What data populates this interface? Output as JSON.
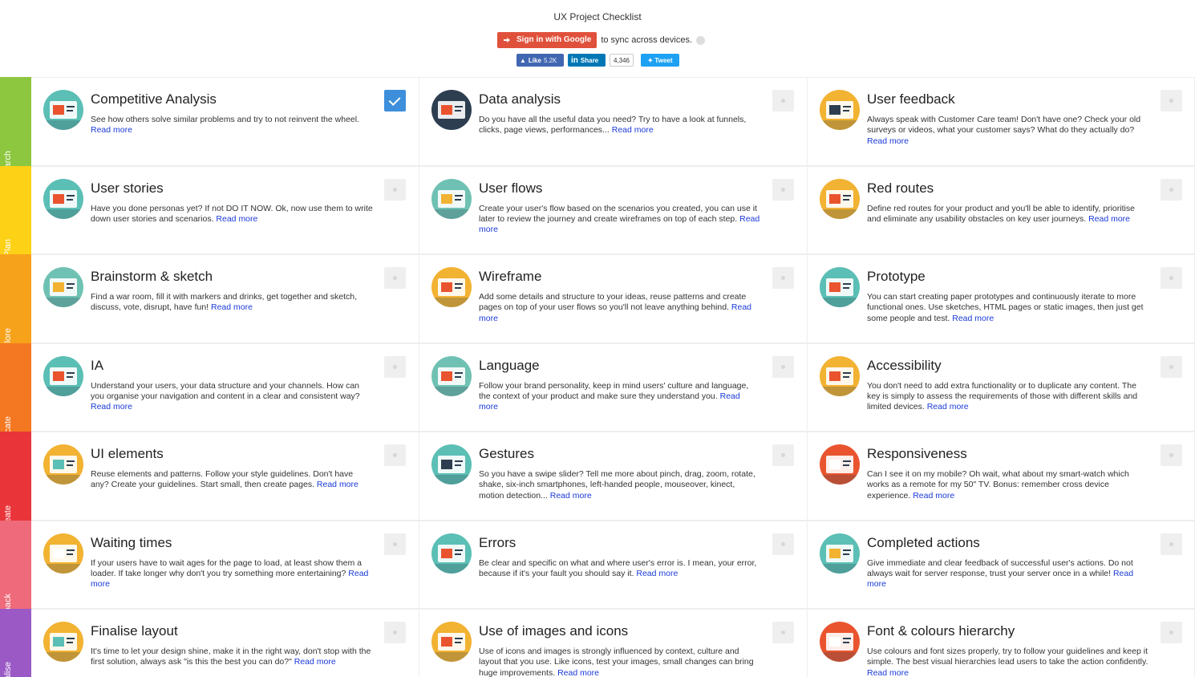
{
  "header": {
    "title": "UX Project Checklist",
    "signin_label": "Sign in with Google",
    "sync_text": "to sync across devices.",
    "facebook_like": "Like",
    "facebook_count": "5.2K",
    "linkedin_label": "Share",
    "linkedin_count": "4,346",
    "tweet_label": "Tweet"
  },
  "read_more": "Read more",
  "stages": [
    {
      "label": "Research",
      "color": "#8dc63f"
    },
    {
      "label": "Plan",
      "color": "#fcd116"
    },
    {
      "label": "Explore",
      "color": "#f7a21b"
    },
    {
      "label": "Communicate",
      "color": "#f47721"
    },
    {
      "label": "Create",
      "color": "#e9353a"
    },
    {
      "label": "Give feedback",
      "color": "#ef6a7a"
    },
    {
      "label": "Finalise",
      "color": "#9b59c5"
    }
  ],
  "items": [
    {
      "title": "Competitive Analysis",
      "desc": "See how others solve similar problems and try to not reinvent the wheel.",
      "checked": true,
      "icon": "magnifier-icon",
      "icon_bg": "#5bbfb5",
      "icon_fg": "#e9542f"
    },
    {
      "title": "Data analysis",
      "desc": "Do you have all the useful data you need? Try to have a look at funnels, clicks, page views, performances...",
      "checked": false,
      "icon": "analytics-icon",
      "icon_bg": "#2d3e50",
      "icon_fg": "#e9542f"
    },
    {
      "title": "User feedback",
      "desc": "Always speak with Customer Care team! Don't have one? Check your old surveys or videos, what your customer says? What do they actually do?",
      "checked": false,
      "icon": "feedback-icon",
      "icon_bg": "#f2b232",
      "icon_fg": "#2d3e50"
    },
    {
      "title": "User stories",
      "desc": "Have you done personas yet? If not DO IT NOW. Ok, now use them to write down user stories and scenarios.",
      "checked": false,
      "icon": "persona-icon",
      "icon_bg": "#5bbfb5",
      "icon_fg": "#e9542f"
    },
    {
      "title": "User flows",
      "desc": "Create your user's flow based on the scenarios you created, you can use it later to review the journey and create wireframes on top of each step.",
      "checked": false,
      "icon": "flow-icon",
      "icon_bg": "#6fc2b3",
      "icon_fg": "#f2b232"
    },
    {
      "title": "Red routes",
      "desc": "Define red routes for your product and you'll be able to identify, prioritise and eliminate any usability obstacles on key user journeys.",
      "checked": false,
      "icon": "route-icon",
      "icon_bg": "#f2b232",
      "icon_fg": "#e9542f"
    },
    {
      "title": "Brainstorm & sketch",
      "desc": "Find a war room, fill it with markers and drinks, get together and sketch, discuss, vote, disrupt, have fun!",
      "checked": false,
      "icon": "beer-icon",
      "icon_bg": "#6fc2b3",
      "icon_fg": "#f2b232"
    },
    {
      "title": "Wireframe",
      "desc": "Add some details and structure to your ideas, reuse patterns and create pages on top of your user flows so you'll not leave anything behind.",
      "checked": false,
      "icon": "wireframe-icon",
      "icon_bg": "#f2b232",
      "icon_fg": "#e9542f"
    },
    {
      "title": "Prototype",
      "desc": "You can start creating paper prototypes and continuously iterate to more functional ones. Use sketches, HTML pages or static images, then just get some people and test.",
      "checked": false,
      "icon": "gears-icon",
      "icon_bg": "#5bbfb5",
      "icon_fg": "#e9542f"
    },
    {
      "title": "IA",
      "desc": "Understand your users, your data structure and your channels. How can you organise your navigation and content in a clear and consistent way?",
      "checked": false,
      "icon": "sitemap-icon",
      "icon_bg": "#5bbfb5",
      "icon_fg": "#e9542f"
    },
    {
      "title": "Language",
      "desc": "Follow your brand personality, keep in mind users' culture and language, the context of your product and make sure they understand you.",
      "checked": false,
      "icon": "typewriter-icon",
      "icon_bg": "#6fc2b3",
      "icon_fg": "#e9542f"
    },
    {
      "title": "Accessibility",
      "desc": "You don't need to add extra functionality or to duplicate any content. The key is simply to assess the requirements of those with different skills and limited devices.",
      "checked": false,
      "icon": "wheelchair-icon",
      "icon_bg": "#f2b232",
      "icon_fg": "#e9542f"
    },
    {
      "title": "UI elements",
      "desc": "Reuse elements and patterns. Follow your style guidelines. Don't have any? Create your guidelines. Start small, then create pages.",
      "checked": false,
      "icon": "form-icon",
      "icon_bg": "#f2b232",
      "icon_fg": "#5bbfb5"
    },
    {
      "title": "Gestures",
      "desc": "So you have a swipe slider? Tell me more about pinch, drag, zoom, rotate, shake, six-inch smartphones, left-handed people, mouseover, kinect, motion detection...",
      "checked": false,
      "icon": "phone-icon",
      "icon_bg": "#5bbfb5",
      "icon_fg": "#2d3e50"
    },
    {
      "title": "Responsiveness",
      "desc": "Can I see it on my mobile? Oh wait, what about my smart-watch which works as a remote for my 50\" TV. Bonus: remember cross device experience.",
      "checked": false,
      "icon": "devices-icon",
      "icon_bg": "#e9542f",
      "icon_fg": "#ffffff"
    },
    {
      "title": "Waiting times",
      "desc": "If your users have to wait ages for the page to load, at least show them a loader. If take longer why don't you try something more entertaining?",
      "checked": false,
      "icon": "plate-icon",
      "icon_bg": "#f2b232",
      "icon_fg": "#ffffff"
    },
    {
      "title": "Errors",
      "desc": "Be clear and specific on what and where user's error is. I mean, your error, because if it's your fault you should say it.",
      "checked": false,
      "icon": "error-icon",
      "icon_bg": "#5bbfb5",
      "icon_fg": "#e9542f"
    },
    {
      "title": "Completed actions",
      "desc": "Give immediate and clear feedback of successful user's actions. Do not always wait for server response, trust your server once in a while!",
      "checked": false,
      "icon": "thumbs-up-icon",
      "icon_bg": "#5bbfb5",
      "icon_fg": "#f2b232"
    },
    {
      "title": "Finalise layout",
      "desc": "It's time to let your design shine, make it in the right way, don't stop with the first solution, always ask \"is this the best you can do?\"",
      "checked": false,
      "icon": "layout-star-icon",
      "icon_bg": "#f2b232",
      "icon_fg": "#5bbfb5"
    },
    {
      "title": "Use of images and icons",
      "desc": "Use of icons and images is strongly influenced by context, culture and layout that you use. Like icons, test your images, small changes can bring huge improvements.",
      "checked": false,
      "icon": "cart-icon",
      "icon_bg": "#f2b232",
      "icon_fg": "#e9542f"
    },
    {
      "title": "Font & colours hierarchy",
      "desc": "Use colours and font sizes properly, try to follow your guidelines and keep it simple. The best visual hierarchies lead users to take the action confidently.",
      "checked": false,
      "icon": "typography-icon",
      "icon_bg": "#e9542f",
      "icon_fg": "#ffffff"
    }
  ]
}
